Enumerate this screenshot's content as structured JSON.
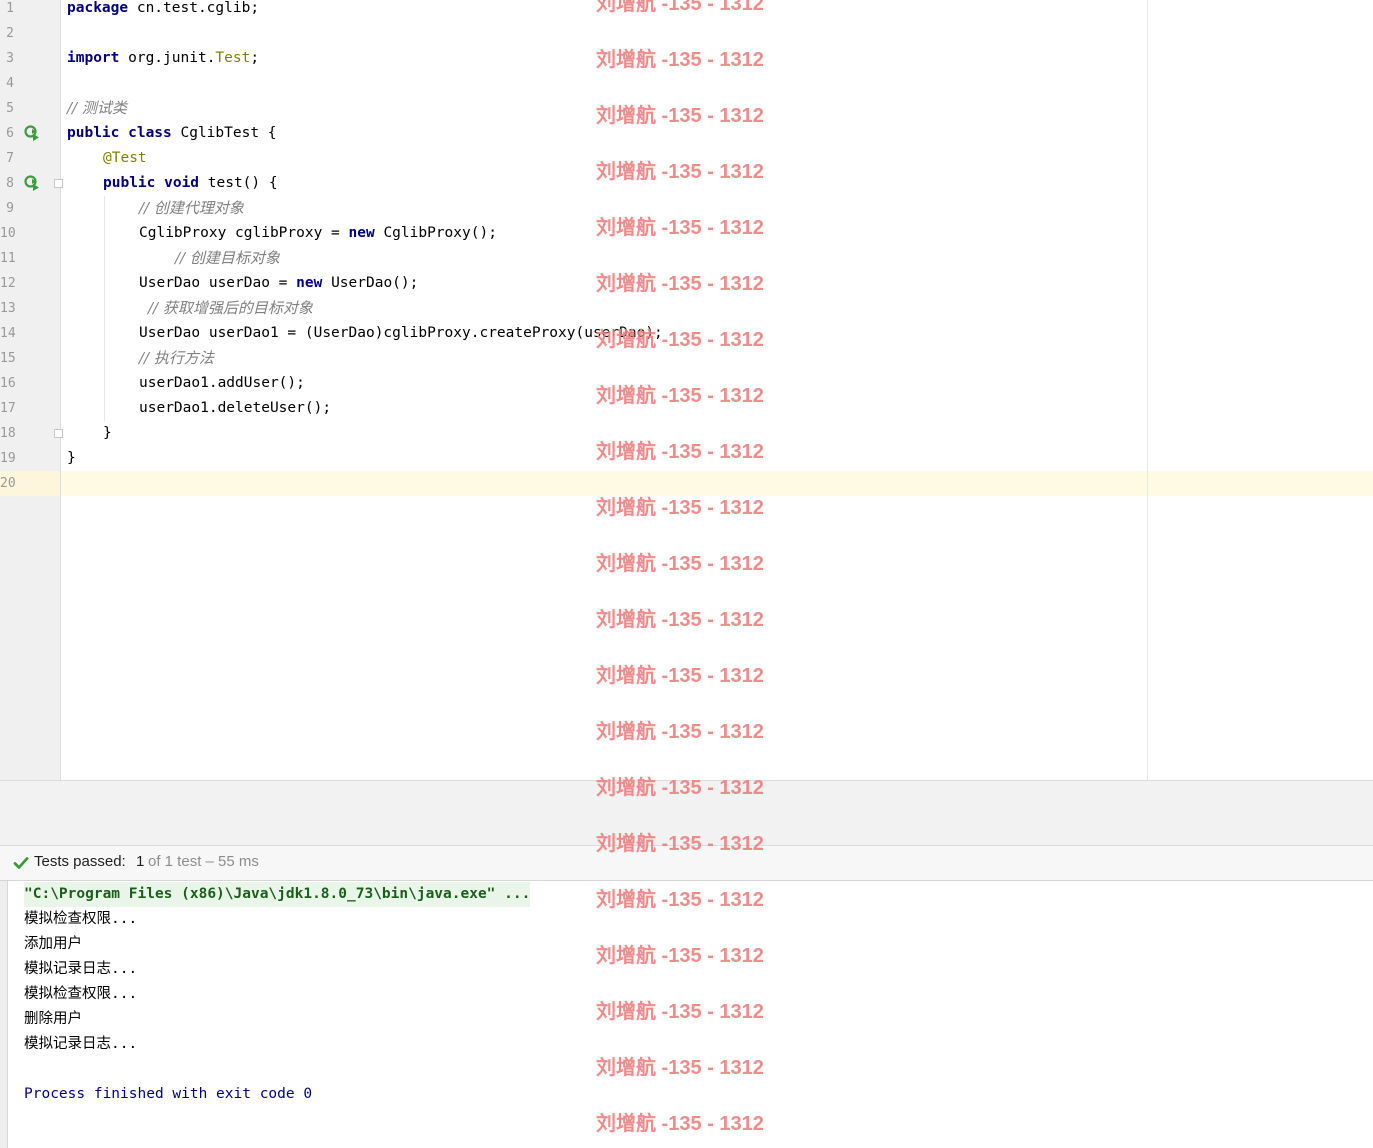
{
  "editor": {
    "line_numbers": [
      "1",
      "2",
      "3",
      "4",
      "5",
      "6",
      "7",
      "8",
      "9",
      "10",
      "11",
      "12",
      "13",
      "14",
      "15",
      "16",
      "17",
      "18",
      "19",
      "20"
    ],
    "code": {
      "l1_kw": "package",
      "l1_rest": " cn.test.cglib;",
      "l3_kw": "import",
      "l3_pkg": " org.junit.",
      "l3_cls": "Test",
      "l3_semi": ";",
      "l5_comment": "// 测试类",
      "l6_kw": "public class",
      "l6_rest": " CglibTest {",
      "l7_annotation": "@Test",
      "l8_kw": "public void",
      "l8_rest": " test() {",
      "l9_comment": "// 创建代理对象",
      "l10_pre": "CglibProxy cglibProxy = ",
      "l10_kw": "new",
      "l10_post": " CglibProxy();",
      "l11_comment": "// 创建目标对象",
      "l12_pre": "UserDao userDao = ",
      "l12_kw": "new",
      "l12_post": " UserDao();",
      "l13_comment": "// 获取增强后的目标对象",
      "l14": "UserDao userDao1 = (UserDao)cglibProxy.createProxy(userDao);",
      "l15_comment": "// 执行方法",
      "l16": "userDao1.addUser();",
      "l17": "userDao1.deleteUser();",
      "l18": "}",
      "l19": "}"
    }
  },
  "test_status": {
    "label": "Tests passed:",
    "count": "1",
    "detail": "of 1 test – 55 ms"
  },
  "console": {
    "command": "\"C:\\Program Files (x86)\\Java\\jdk1.8.0_73\\bin\\java.exe\" ...",
    "output": [
      "模拟检查权限...",
      "添加用户",
      "模拟记录日志...",
      "模拟检查权限...",
      "删除用户",
      "模拟记录日志..."
    ],
    "exit_message": "Process finished with exit code 0"
  },
  "watermark": {
    "text": "刘增航 -135 - 1312"
  },
  "colors": {
    "keyword": "#000080",
    "annotation": "#808000",
    "comment": "#808080",
    "pass_green": "#3b9b3b",
    "watermark": "#ef7f7f"
  }
}
